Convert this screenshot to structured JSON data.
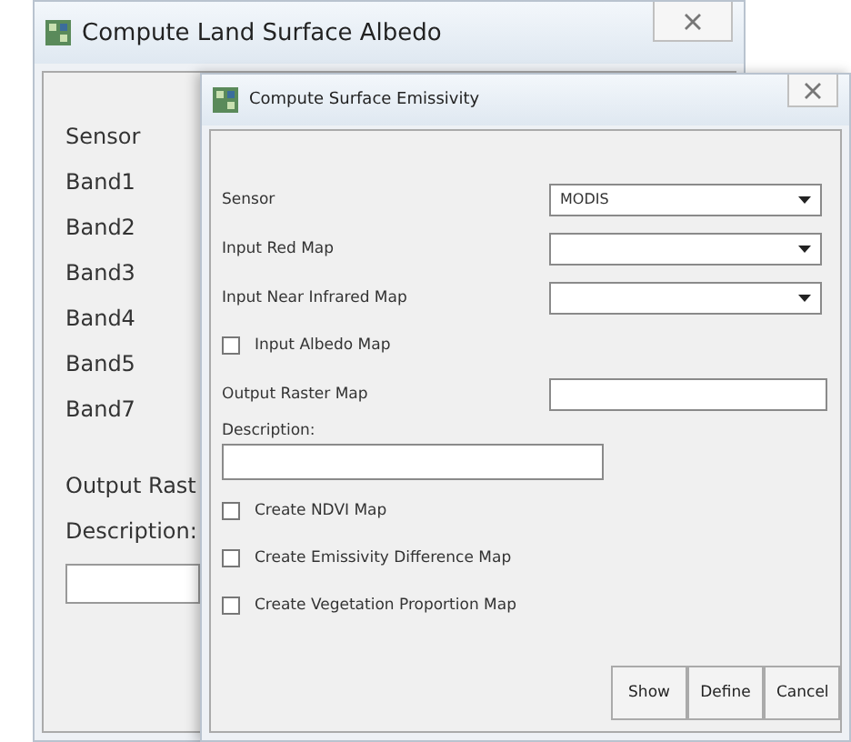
{
  "back_window": {
    "title": "Compute Land Surface Albedo",
    "labels": [
      "Sensor",
      "Band1",
      "Band2",
      "Band3",
      "Band4",
      "Band5",
      "Band7"
    ],
    "output_label": "Output Rast",
    "description_label": "Description:"
  },
  "front_window": {
    "title": "Compute Surface Emissivity",
    "rows": [
      {
        "kind": "select",
        "label": "Sensor",
        "value": "MODIS"
      },
      {
        "kind": "select",
        "label": "Input Red Map"
      },
      {
        "kind": "select",
        "label": "Input Near Infrared Map"
      },
      {
        "kind": "check",
        "label": "Input Albedo Map",
        "checked": false
      },
      {
        "kind": "text",
        "label": "Output Raster Map"
      }
    ],
    "description_label": "Description:",
    "options": [
      {
        "label": "Create NDVI Map",
        "checked": false
      },
      {
        "label": "Create Emissivity Difference Map",
        "checked": false
      },
      {
        "label": "Create Vegetation Proportion Map",
        "checked": false
      }
    ],
    "buttons": [
      "Show",
      "Define",
      "Cancel"
    ]
  }
}
